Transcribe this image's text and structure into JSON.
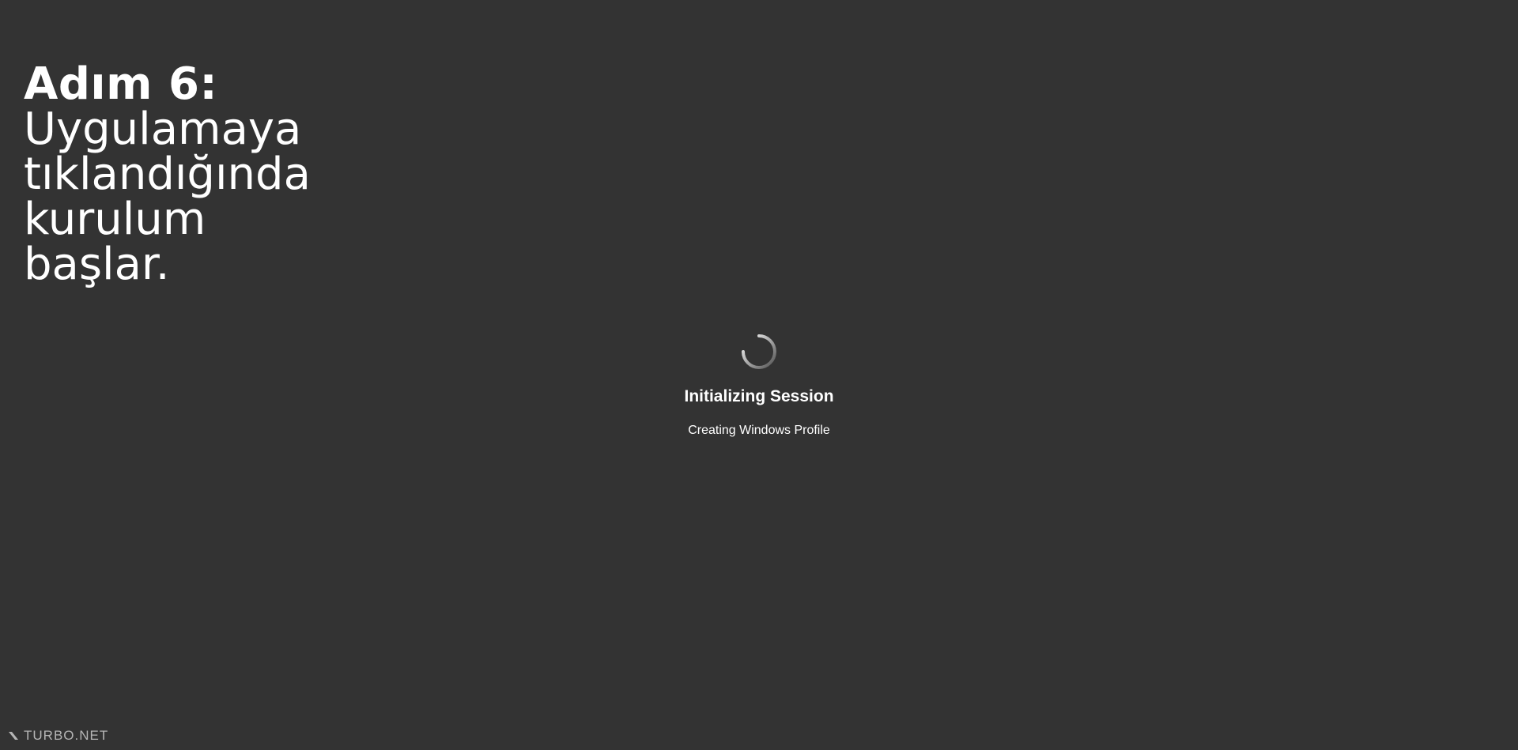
{
  "caption": {
    "heading": "Adım 6:",
    "body": "Uygulamaya\ntıklandığında\nkurulum\nbaşlar."
  },
  "session": {
    "title": "Initializing Session",
    "status": "Creating Windows Profile",
    "spinner_icon": "loading-spinner-icon"
  },
  "brand": {
    "name": "TURBO.NET",
    "logo_icon": "turbo-logo-icon"
  },
  "colors": {
    "background": "#333333",
    "text": "#ffffff",
    "brand_text": "#b5b5b5"
  }
}
